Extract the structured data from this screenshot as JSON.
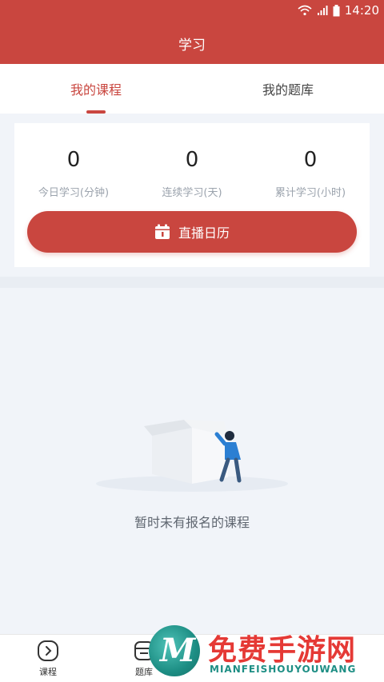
{
  "status_bar": {
    "time": "14:20"
  },
  "header": {
    "title": "学习"
  },
  "tabs": [
    {
      "label": "我的课程",
      "active": true
    },
    {
      "label": "我的题库",
      "active": false
    }
  ],
  "stats": [
    {
      "value": "0",
      "label": "今日学习(分钟)"
    },
    {
      "value": "0",
      "label": "连续学习(天)"
    },
    {
      "value": "0",
      "label": "累计学习(小时)"
    }
  ],
  "calendar_button": {
    "label": "直播日历",
    "icon": "calendar-icon"
  },
  "empty_state": {
    "text": "暂时未有报名的课程",
    "icon": "empty-box-icon"
  },
  "bottom_nav": [
    {
      "label": "课程",
      "icon": "play-circle-icon"
    },
    {
      "label": "题库",
      "icon": "question-bank-icon"
    }
  ],
  "watermark": {
    "title": "免费手游网",
    "subtitle": "MIANFEISHOUYOUWANG",
    "logo_letter": "M"
  },
  "colors": {
    "brand": "#c9463f",
    "background": "#f1f4f9",
    "muted_text": "#9ba3ad"
  }
}
